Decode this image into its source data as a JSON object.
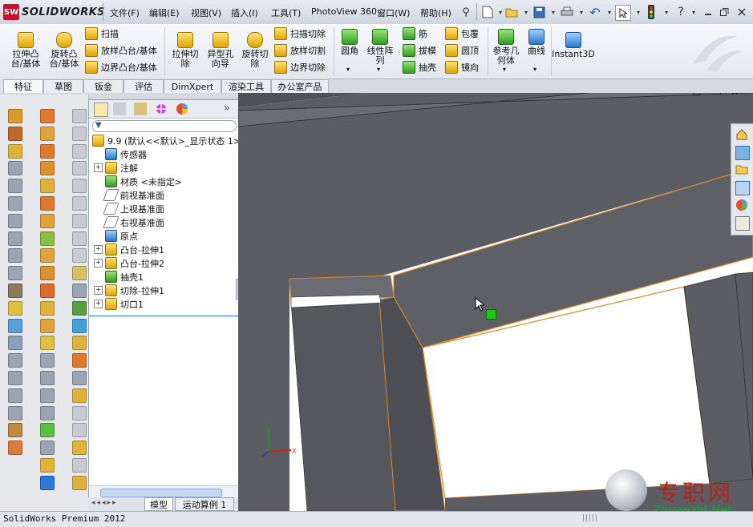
{
  "app": {
    "logo_text": "SOLIDWORKS",
    "logo_badge": "SW"
  },
  "menu": [
    "文件(F)",
    "编辑(E)",
    "视图(V)",
    "插入(I)",
    "工具(T)",
    "PhotoView 360",
    "窗口(W)",
    "帮助(H)"
  ],
  "title_icons": {
    "help": "?"
  },
  "ribbon": {
    "big": [
      {
        "label": "拉伸凸\n台/基体"
      },
      {
        "label": "旋转凸\n台/基体"
      },
      {
        "label": "拉伸切\n除"
      },
      {
        "label": "异型孔\n向导"
      },
      {
        "label": "旋转切\n除"
      },
      {
        "label": "圆角"
      },
      {
        "label": "线性阵\n列"
      },
      {
        "label": "参考几\n何体"
      },
      {
        "label": "曲线"
      },
      {
        "label": "Instant3D"
      }
    ],
    "small_a": [
      "扫描",
      "放样凸台/基体",
      "边界凸台/基体"
    ],
    "small_b": [
      "扫描切除",
      "放样切割",
      "边界切除"
    ],
    "small_c": [
      "筋",
      "拔模",
      "抽壳"
    ],
    "small_d": [
      "包覆",
      "圆顶",
      "镜向"
    ]
  },
  "tabs": [
    "特征",
    "草图",
    "钣金",
    "评估",
    "DimXpert",
    "渲染工具",
    "办公室产品"
  ],
  "tree": {
    "root": "9.9  (默认<<默认>_显示状态 1>",
    "items": [
      {
        "label": "传感器",
        "expand": false
      },
      {
        "label": "注解",
        "expand": true
      },
      {
        "label": "材质 <未指定>",
        "expand": false
      },
      {
        "label": "前视基准面",
        "expand": false
      },
      {
        "label": "上视基准面",
        "expand": false
      },
      {
        "label": "右视基准面",
        "expand": false
      },
      {
        "label": "原点",
        "expand": false
      },
      {
        "label": "凸台-拉伸1",
        "expand": true
      },
      {
        "label": "凸台-拉伸2",
        "expand": true
      },
      {
        "label": "抽壳1",
        "expand": false
      },
      {
        "label": "切除-拉伸1",
        "expand": true
      },
      {
        "label": "切口1",
        "expand": true
      }
    ],
    "filter_icon": "filter-icon"
  },
  "bottom_tabs": [
    "模型",
    "运动算例 1"
  ],
  "status": {
    "text": "SolidWorks Premium 2012"
  },
  "watermark": {
    "brand": "专职网",
    "url": "Zhuanzhi.Net"
  },
  "colors": {
    "accent": "#c8102e",
    "model_face": "#5b5d62",
    "edge": "#d88a2a",
    "selection": "#19a119"
  }
}
